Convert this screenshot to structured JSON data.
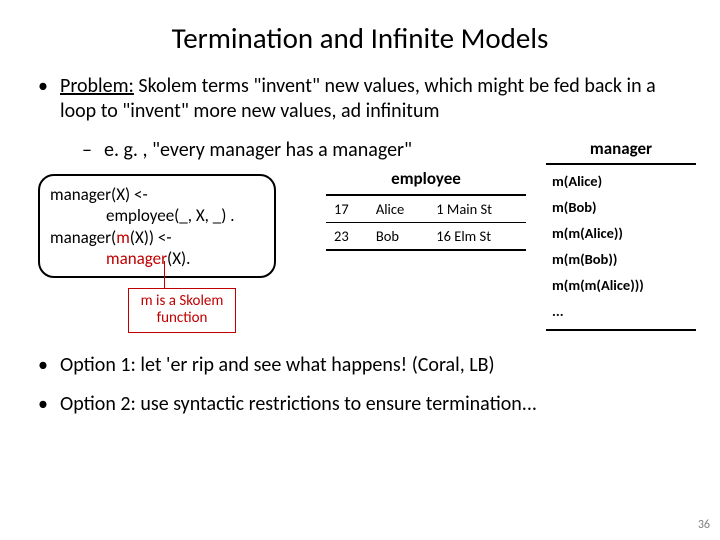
{
  "title": "Termination and Infinite Models",
  "problem_label": "Problem:",
  "problem_text": " Skolem terms \"invent\" new values, which might be fed back in a loop to \"invent\" more new values, ad infinitum",
  "example": "e. g. , \"every manager has a manager\"",
  "rules": {
    "l1a": "manager(X) <-",
    "l2a": "employee(_, X, _) .",
    "l3a": "manager(",
    "l3m": "m",
    "l3b": "(X)) <-",
    "l4a": "manager",
    "l4b": "(X)."
  },
  "skolem_label_l1": "m is a Skolem",
  "skolem_label_l2": "function",
  "employee": {
    "title": "employee",
    "rows": [
      {
        "id": "17",
        "name": "Alice",
        "addr": "1 Main St"
      },
      {
        "id": "23",
        "name": "Bob",
        "addr": "16 Elm St"
      }
    ]
  },
  "manager": {
    "title": "manager",
    "items": [
      "m(Alice)",
      "m(Bob)",
      "m(m(Alice))",
      "m(m(Bob))",
      "m(m(m(Alice)))",
      "..."
    ]
  },
  "option1": "Option 1: let 'er rip and see what happens!  (Coral, LB)",
  "option2": "Option 2: use syntactic restrictions to ensure termination...",
  "pagenum": "36"
}
